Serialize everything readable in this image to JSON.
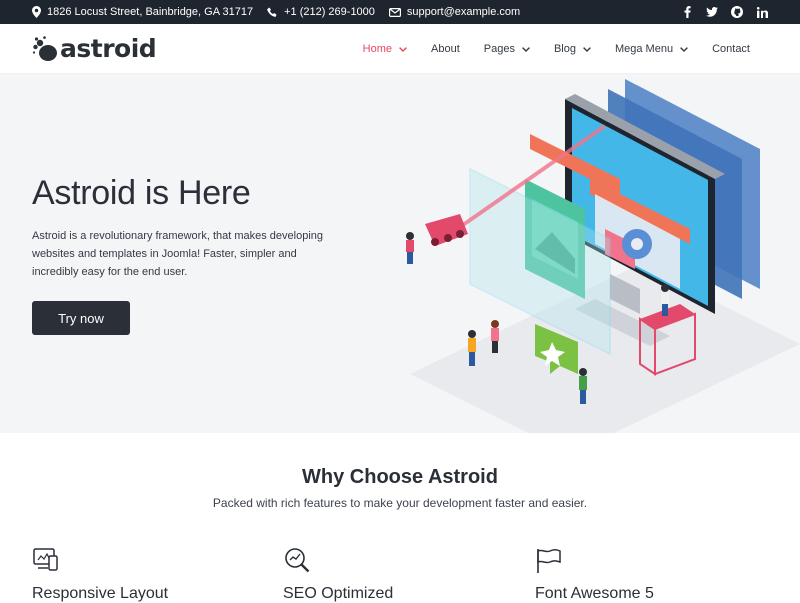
{
  "topbar": {
    "address": "1826 Locust Street, Bainbridge, GA 31717",
    "phone": "+1 (212) 269-1000",
    "email": "support@example.com",
    "social": [
      "facebook-icon",
      "twitter-icon",
      "github-icon",
      "linkedin-icon"
    ]
  },
  "header": {
    "logo_text": "astroid",
    "nav": [
      {
        "label": "Home",
        "active": true,
        "has_dropdown": true
      },
      {
        "label": "About",
        "active": false,
        "has_dropdown": false
      },
      {
        "label": "Pages",
        "active": false,
        "has_dropdown": true
      },
      {
        "label": "Blog",
        "active": false,
        "has_dropdown": true
      },
      {
        "label": "Mega Menu",
        "active": false,
        "has_dropdown": true
      },
      {
        "label": "Contact",
        "active": false,
        "has_dropdown": false
      }
    ]
  },
  "hero": {
    "title": "Astroid is Here",
    "description": "Astroid is a revolutionary framework, that makes developing websites and templates in Joomla! Faster, simpler and incredibly easy for the end user.",
    "button": "Try now"
  },
  "why": {
    "title": "Why Choose Astroid",
    "subtitle": "Packed with rich features to make your development faster and easier.",
    "features": [
      {
        "title": "Responsive Layout",
        "icon": "devices-icon"
      },
      {
        "title": "SEO Optimized",
        "icon": "seo-magnifier-icon"
      },
      {
        "title": "Font Awesome 5",
        "icon": "flag-icon"
      }
    ]
  },
  "colors": {
    "accent": "#e8475f",
    "dark": "#1f252e",
    "hero_bg": "#f4f5f7"
  }
}
